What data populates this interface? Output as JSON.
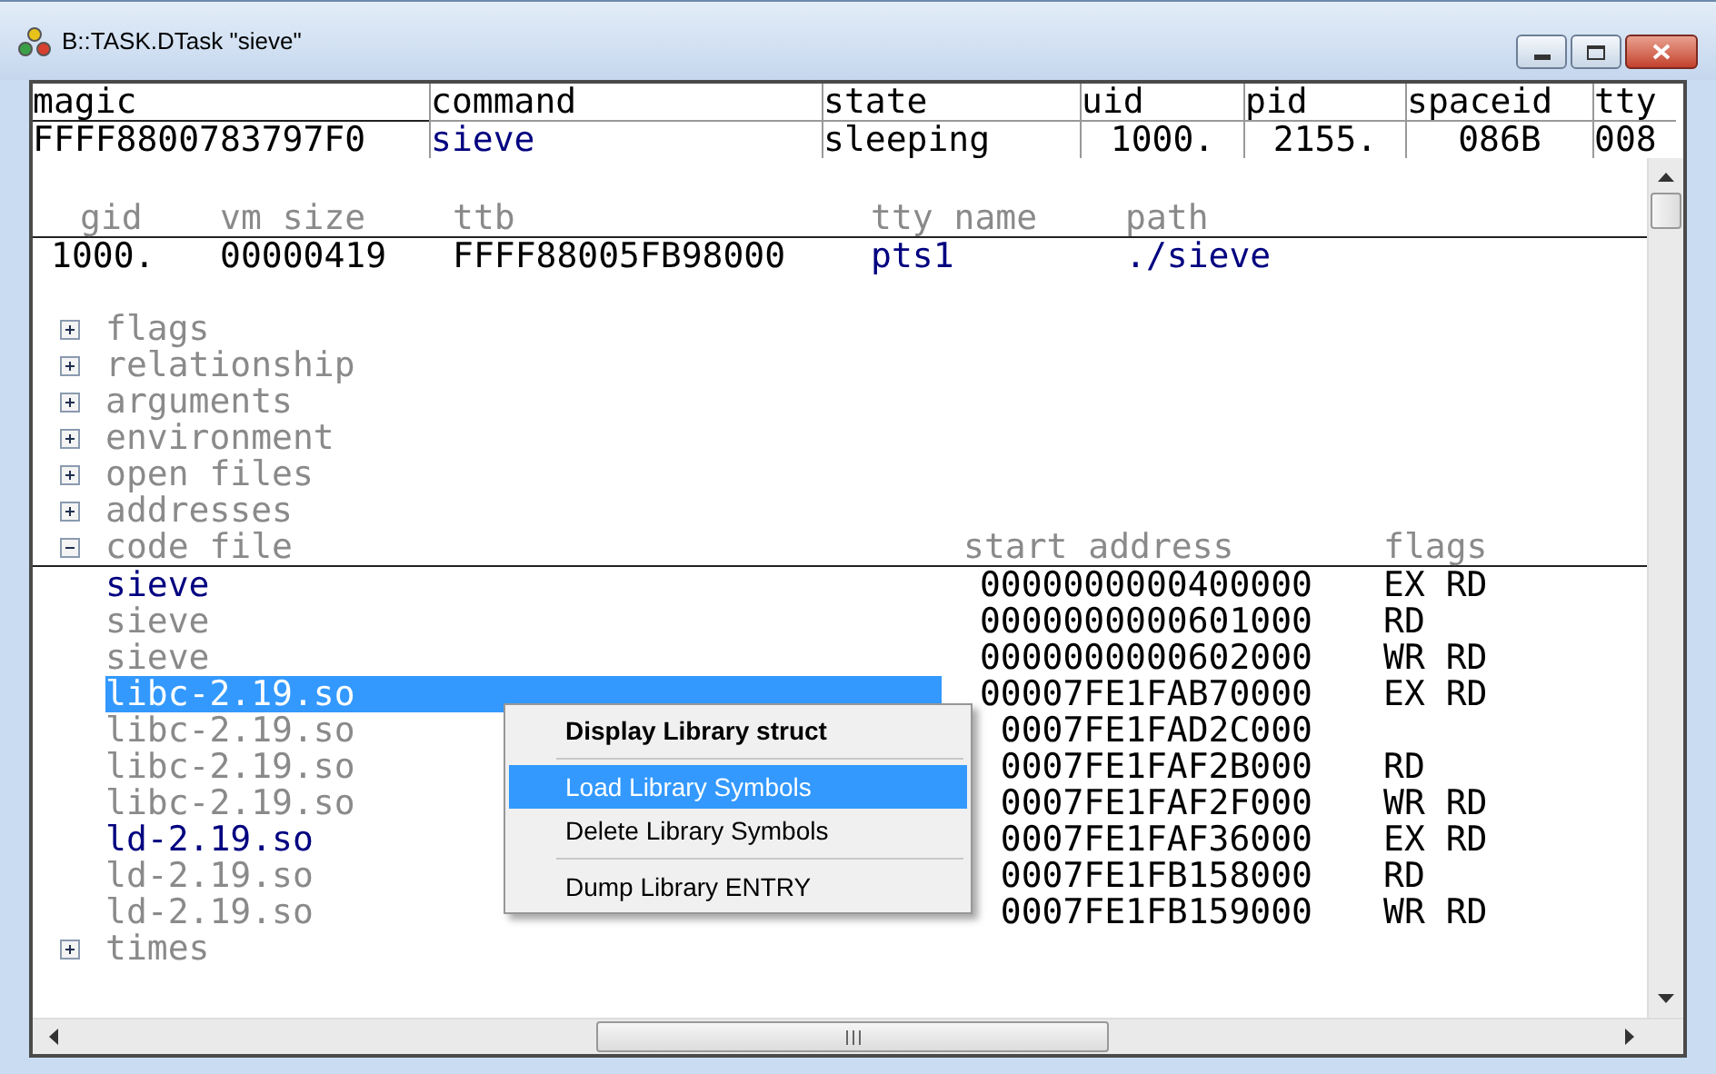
{
  "window": {
    "title": "B::TASK.DTask \"sieve\""
  },
  "main_table": {
    "columns": [
      "magic",
      "command",
      "state",
      "uid",
      "pid",
      "spaceid",
      "tty"
    ],
    "row": [
      {
        "text": "FFFF8800783797F0",
        "kind": "plain"
      },
      {
        "text": "sieve",
        "kind": "link"
      },
      {
        "text": "sleeping",
        "kind": "plain"
      },
      {
        "text": "1000.",
        "kind": "plain"
      },
      {
        "text": "2155.",
        "kind": "plain"
      },
      {
        "text": "086B",
        "kind": "plain"
      },
      {
        "text": "008",
        "kind": "plain"
      }
    ]
  },
  "detail_table": {
    "columns": [
      "gid",
      "vm size",
      "ttb",
      "tty name",
      "path"
    ],
    "row": [
      {
        "text": "1000.",
        "kind": "plain"
      },
      {
        "text": "00000419",
        "kind": "plain"
      },
      {
        "text": "FFFF88005FB98000",
        "kind": "plain"
      },
      {
        "text": "pts1",
        "kind": "link"
      },
      {
        "text": "./sieve",
        "kind": "link"
      }
    ]
  },
  "tree": {
    "items": [
      {
        "label": "flags",
        "expanded": false
      },
      {
        "label": "relationship",
        "expanded": false
      },
      {
        "label": "arguments",
        "expanded": false
      },
      {
        "label": "environment",
        "expanded": false
      },
      {
        "label": "open files",
        "expanded": false
      },
      {
        "label": "addresses",
        "expanded": false
      },
      {
        "label": "code file",
        "expanded": true,
        "columns": [
          "start address",
          "flags"
        ],
        "children": [
          {
            "name": "sieve",
            "address": "0000000000400000",
            "flags": "EX RD",
            "kind": "link",
            "selected": false
          },
          {
            "name": "sieve",
            "address": "0000000000601000",
            "flags": "RD",
            "kind": "plain",
            "selected": false
          },
          {
            "name": "sieve",
            "address": "0000000000602000",
            "flags": "WR RD",
            "kind": "plain",
            "selected": false
          },
          {
            "name": "libc-2.19.so",
            "address": "00007FE1FAB70000",
            "flags": "EX RD",
            "kind": "link",
            "selected": true
          },
          {
            "name": "libc-2.19.so",
            "address": "0007FE1FAD2C000",
            "kind": "plain",
            "selected": false
          },
          {
            "name": "libc-2.19.so",
            "address": "0007FE1FAF2B000",
            "flags": "RD",
            "kind": "plain",
            "selected": false
          },
          {
            "name": "libc-2.19.so",
            "address": "0007FE1FAF2F000",
            "flags": "WR RD",
            "kind": "plain",
            "selected": false
          },
          {
            "name": "ld-2.19.so",
            "address": "0007FE1FAF36000",
            "flags": "EX RD",
            "kind": "link",
            "selected": false
          },
          {
            "name": "ld-2.19.so",
            "address": "0007FE1FB158000",
            "flags": "RD",
            "kind": "plain",
            "selected": false
          },
          {
            "name": "ld-2.19.so",
            "address": "0007FE1FB159000",
            "flags": "WR RD",
            "kind": "plain",
            "selected": false
          }
        ]
      },
      {
        "label": "times",
        "expanded": false
      }
    ]
  },
  "context_menu": {
    "items": [
      {
        "kind": "default",
        "label": "Display Library struct",
        "selected": false
      },
      {
        "kind": "separator"
      },
      {
        "kind": "item",
        "label": "Load Library Symbols",
        "selected": true
      },
      {
        "kind": "item",
        "label": "Delete Library Symbols",
        "selected": false
      },
      {
        "kind": "separator"
      },
      {
        "kind": "item",
        "label": "Dump Library ENTRY",
        "selected": false
      }
    ]
  }
}
